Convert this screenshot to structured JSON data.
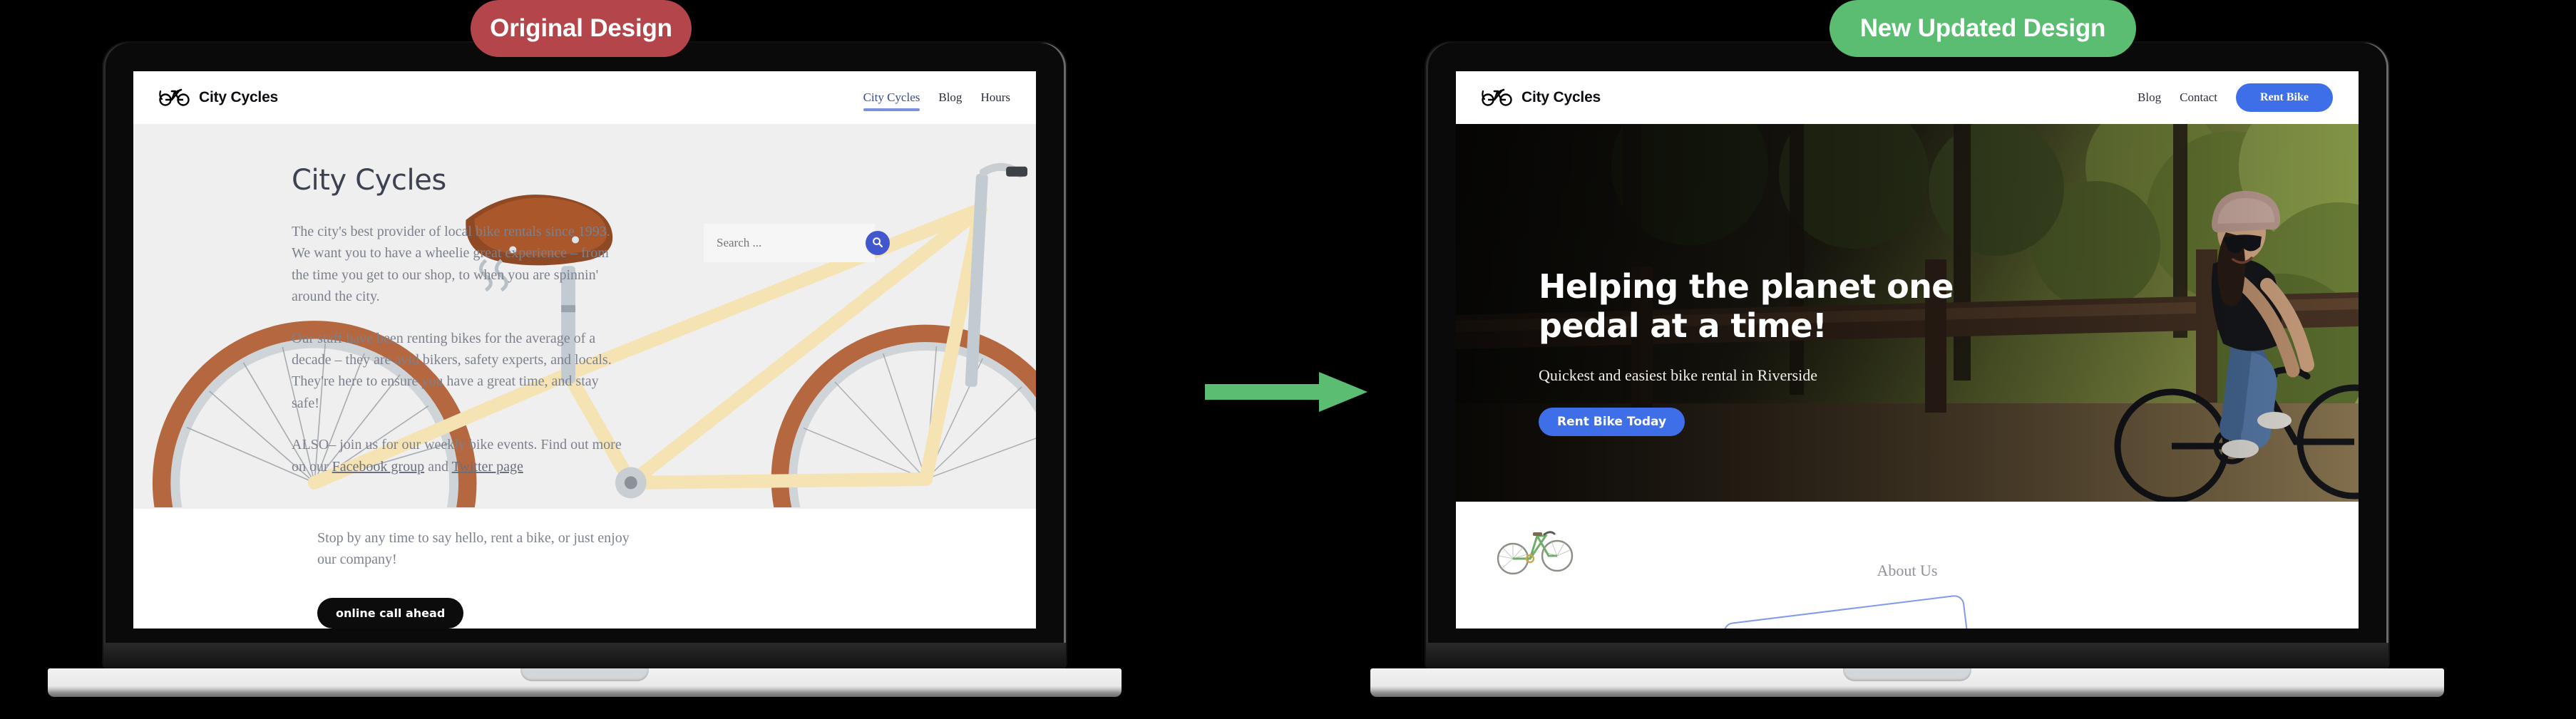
{
  "badges": {
    "left": {
      "label": "Original Design",
      "color": "#b4454a"
    },
    "right": {
      "label": "New Updated Design",
      "color": "#5bbd72"
    }
  },
  "arrow": {
    "name": "right-arrow",
    "color": "#5bbd72"
  },
  "original_design": {
    "nav": {
      "brand": "City Cycles",
      "logo_icon": "bicycle-icon",
      "links": [
        {
          "label": "City Cycles",
          "active": true
        },
        {
          "label": "Blog",
          "active": false
        },
        {
          "label": "Hours",
          "active": false
        }
      ]
    },
    "hero": {
      "title": "City Cycles",
      "background_image": "vintage-cream-bicycle-photo",
      "paragraphs": [
        "The city's best provider of local bike rentals since 1993. We want you to have a wheelie great experience – from the time you get to our shop, to when you are spinnin' around the city.",
        "Our staff have been renting bikes for the average of a decade – they are avid bikers, safety experts, and locals. They're here to ensure you have a great time, and stay safe!"
      ],
      "also_paragraph": {
        "prefix": "ALSO– join us for our weekly bike events. Find out more on our ",
        "link1": "Facebook group",
        "middle": " and ",
        "link2": "Twitter page"
      },
      "closing_paragraph": "Stop by any time to say hello, rent a bike, or just enjoy our company!",
      "cta_label": "online call ahead"
    },
    "search": {
      "placeholder": "Search ...",
      "value": "",
      "button_icon": "search-icon",
      "button_color": "#4057cf"
    }
  },
  "new_design": {
    "nav": {
      "brand": "City Cycles",
      "logo_icon": "bicycle-icon",
      "links": [
        {
          "label": "Blog"
        },
        {
          "label": "Contact"
        }
      ],
      "cta_label": "Rent Bike",
      "cta_color": "#3f6fe8"
    },
    "hero": {
      "background_image": "woman-riding-bicycle-in-forest-photo",
      "heading": "Helping the planet one pedal at a time!",
      "subheading": "Quickest and easiest bike rental in Riverside",
      "cta_label": "Rent Bike Today"
    },
    "below": {
      "about_label": "About Us",
      "mini_image": "green-bicycle-illustration"
    }
  }
}
